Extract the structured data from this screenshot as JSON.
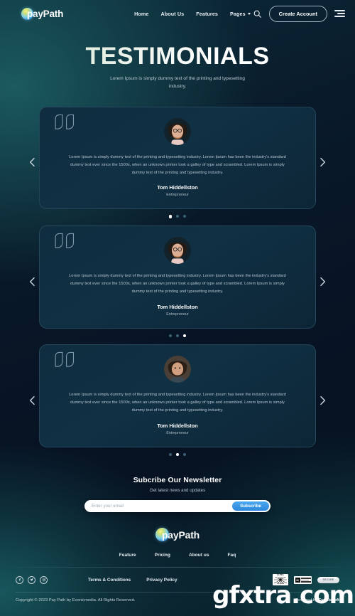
{
  "nav": {
    "brand_pay": "pay",
    "brand_path": "Path",
    "links": [
      {
        "label": "Home",
        "has_caret": false
      },
      {
        "label": "About Us",
        "has_caret": false
      },
      {
        "label": "Features",
        "has_caret": false
      },
      {
        "label": "Pages",
        "has_caret": true
      }
    ],
    "search_icon": "search-icon",
    "cta_label": "Create Account",
    "menu_icon": "hamburger-menu-icon"
  },
  "hero": {
    "title": "TESTIMONIALS",
    "subtitle": "Lorem Ipsum is simply dummy text of the printing and typesetting industry."
  },
  "testimonials": [
    {
      "quote": "Lorem Ipsum is simply dummy text of the printing and typesetting industry. Lorem Ipsum has been the industry's standard dummy text ever since the 1500s, when an unknown printer took a galley of type and scrambled. Lorem Ipsum is simply dummy text of the printing and typesetting industry.",
      "name": "Tom Hiddellston",
      "role": "Entrepreneur",
      "dots": 3,
      "active_dot": 0,
      "prev_label": "Previous testimonial",
      "next_label": "Next testimonial"
    },
    {
      "quote": "Lorem Ipsum is simply dummy text of the printing and typesetting industry. Lorem Ipsum has been the industry's standard dummy text ever since the 1500s, when an unknown printer took a galley of type and scrambled. Lorem Ipsum is simply dummy text of the printing and typesetting industry.",
      "name": "Tom Hiddellston",
      "role": "Entrepreneur",
      "dots": 3,
      "active_dot": 2,
      "prev_label": "Previous testimonial",
      "next_label": "Next testimonial"
    },
    {
      "quote": "Lorem Ipsum is simply dummy text of the printing and typesetting industry. Lorem Ipsum has been the industry's standard dummy text ever since the 1500s, when an unknown printer took a galley of type and scrambled. Lorem Ipsum is simply dummy text of the printing and typesetting industry.",
      "name": "Tom Hiddellston",
      "role": "Entrepreneur",
      "dots": 3,
      "active_dot": 1,
      "prev_label": "Previous testimonial",
      "next_label": "Next testimonial"
    }
  ],
  "newsletter": {
    "title": "Subcribe Our Newsletter",
    "subtitle": "Get latest news and updates",
    "input_placeholder": "Enter your email",
    "input_value": "",
    "button_label": "Subscribe"
  },
  "footer": {
    "brand_pay": "pay",
    "brand_path": "Path",
    "nav": [
      "Feature",
      "Pricing",
      "About us",
      "Faq"
    ],
    "socials": [
      "facebook-icon",
      "twitter-icon",
      "instagram-icon"
    ],
    "legal": [
      "Terms & Conditions",
      "Privacy Policy"
    ],
    "badges": {
      "ultra_top": "ULTRA",
      "ultra_bottom": "CLEAN",
      "mono_letter": "M",
      "pill_text": "SECURE"
    },
    "copyright": "Copyright © 2023 Pay Path by Evonicmedia. All Rights Reserved.",
    "powered_prefix": "Powered by ",
    "powered_brand": "Evonicsoft"
  },
  "watermark": "gfxtra.com",
  "colors": {
    "accent_blue": "#2e87dc",
    "card_bg": "#103044",
    "page_dark": "#06101d",
    "teal_glow": "#1b5a5f"
  }
}
